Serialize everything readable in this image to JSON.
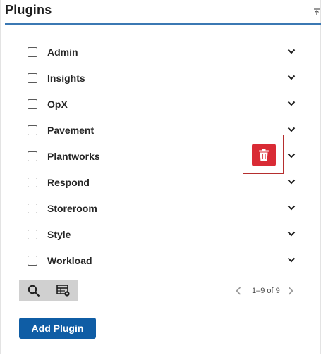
{
  "panel": {
    "title": "Plugins",
    "collapse_icon": "collapse-up-icon"
  },
  "plugins": [
    {
      "label": "Admin"
    },
    {
      "label": "Insights"
    },
    {
      "label": "OpX"
    },
    {
      "label": "Pavement"
    },
    {
      "label": "Plantworks"
    },
    {
      "label": "Respond"
    },
    {
      "label": "Storeroom"
    },
    {
      "label": "Style"
    },
    {
      "label": "Workload"
    }
  ],
  "row_icons": {
    "checkbox": "checkbox-icon",
    "expand": "chevron-down-icon",
    "delete": "trash-icon"
  },
  "toolbar": {
    "search_icon": "search-icon",
    "settings_icon": "table-settings-icon"
  },
  "pagination": {
    "text": "1–9 of 9",
    "prev_icon": "chevron-left-icon",
    "next_icon": "chevron-right-icon"
  },
  "actions": {
    "add_label": "Add Plugin"
  },
  "colors": {
    "accent": "#0f5da5",
    "header_rule": "#3b78b3",
    "delete": "#d92b35",
    "highlight_border": "#b52e2e",
    "toolbar_bg": "#d0d0d0"
  }
}
